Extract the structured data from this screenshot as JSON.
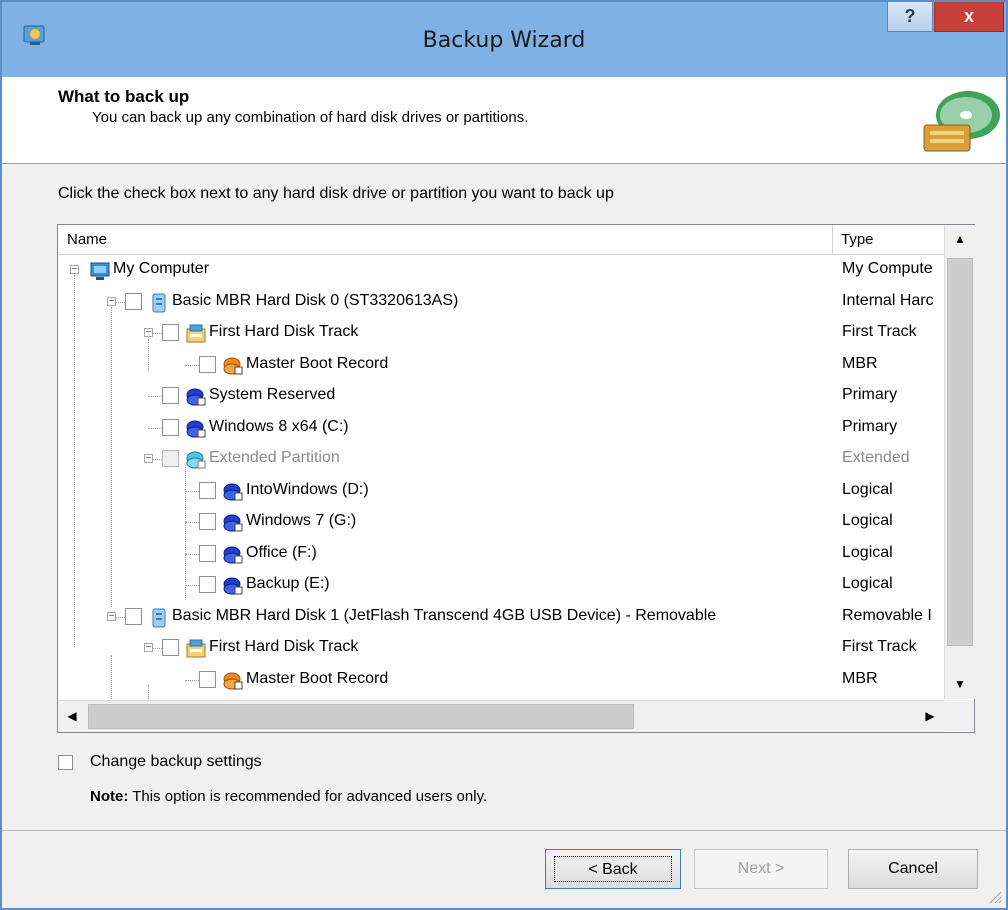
{
  "window": {
    "title": "Backup Wizard",
    "help_label": "?",
    "close_label": "x"
  },
  "header": {
    "title": "What to back up",
    "subtitle": "You can back up any combination of hard disk drives or partitions."
  },
  "instruction": "Click the check box next to any hard disk drive or partition you want to back up",
  "columns": {
    "name": "Name",
    "type": "Type"
  },
  "tree": [
    {
      "label": "My Computer",
      "type": "My Compute",
      "icon": "computer-icon",
      "level": 0,
      "expander": "−",
      "checkbox": false,
      "dim": false
    },
    {
      "label": "Basic MBR Hard Disk 0 (ST3320613AS)",
      "type": "Internal Harc",
      "icon": "hard-disk-icon",
      "level": 1,
      "expander": "−",
      "checkbox": true,
      "dim": false
    },
    {
      "label": "First Hard Disk Track",
      "type": "First Track",
      "icon": "disk-track-icon",
      "level": 2,
      "expander": "−",
      "checkbox": true,
      "dim": false
    },
    {
      "label": "Master Boot Record",
      "type": "MBR",
      "icon": "mbr-partition-icon",
      "level": 3,
      "expander": "",
      "checkbox": true,
      "dim": false
    },
    {
      "label": "System Reserved",
      "type": "Primary",
      "icon": "partition-icon",
      "level": 2,
      "expander": "",
      "checkbox": true,
      "dim": false
    },
    {
      "label": "Windows 8 x64 (C:)",
      "type": "Primary",
      "icon": "partition-icon",
      "level": 2,
      "expander": "",
      "checkbox": true,
      "dim": false
    },
    {
      "label": "Extended Partition",
      "type": "Extended",
      "icon": "extended-partition-icon",
      "level": 2,
      "expander": "−",
      "checkbox": true,
      "dim": true
    },
    {
      "label": "IntoWindows (D:)",
      "type": "Logical",
      "icon": "partition-icon",
      "level": 3,
      "expander": "",
      "checkbox": true,
      "dim": false
    },
    {
      "label": "Windows 7 (G:)",
      "type": "Logical",
      "icon": "partition-icon",
      "level": 3,
      "expander": "",
      "checkbox": true,
      "dim": false
    },
    {
      "label": "Office (F:)",
      "type": "Logical",
      "icon": "partition-icon",
      "level": 3,
      "expander": "",
      "checkbox": true,
      "dim": false
    },
    {
      "label": "Backup (E:)",
      "type": "Logical",
      "icon": "partition-icon",
      "level": 3,
      "expander": "",
      "checkbox": true,
      "dim": false
    },
    {
      "label": "Basic MBR Hard Disk 1 (JetFlash Transcend 4GB USB Device) - Removable",
      "type": "Removable I",
      "icon": "hard-disk-icon",
      "level": 1,
      "expander": "−",
      "checkbox": true,
      "dim": false
    },
    {
      "label": "First Hard Disk Track",
      "type": "First Track",
      "icon": "disk-track-icon",
      "level": 2,
      "expander": "−",
      "checkbox": true,
      "dim": false
    },
    {
      "label": "Master Boot Record",
      "type": "MBR",
      "icon": "mbr-partition-icon",
      "level": 3,
      "expander": "",
      "checkbox": true,
      "dim": false
    }
  ],
  "options": {
    "change_settings_label": "Change backup settings",
    "change_settings_checked": false,
    "note_bold": "Note:",
    "note_text": " This option is recommended for advanced users only."
  },
  "buttons": {
    "back": "< Back",
    "next": "Next >",
    "cancel": "Cancel"
  },
  "colors": {
    "titlebar": "#7fb0e6",
    "close": "#c9403a",
    "partition_blue": "#1f3fd1",
    "mbr_orange": "#f08a1c"
  }
}
